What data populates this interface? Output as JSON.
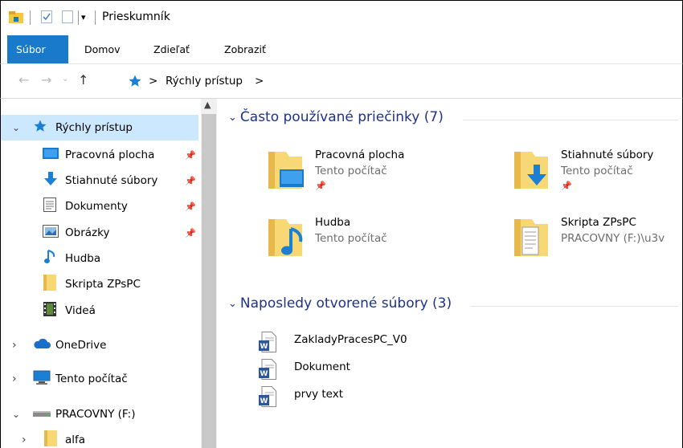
{
  "window": {
    "title": "Prieskumník"
  },
  "ribbon": {
    "tabs": [
      "Súbor",
      "Domov",
      "Zdieľať",
      "Zobraziť"
    ]
  },
  "address": {
    "path": [
      "Rýchly prístup"
    ],
    "separator": ">"
  },
  "sidebar": {
    "items": [
      {
        "label": "Rýchly prístup",
        "icon": "star-icon",
        "expander": "expanded",
        "selected": true
      },
      {
        "label": "Pracovná plocha",
        "icon": "desktop-icon",
        "pinned": true
      },
      {
        "label": "Stiahnuté súbory",
        "icon": "download-icon",
        "pinned": true
      },
      {
        "label": "Dokumenty",
        "icon": "document-icon",
        "pinned": true
      },
      {
        "label": "Obrázky",
        "icon": "pictures-icon",
        "pinned": true
      },
      {
        "label": "Hudba",
        "icon": "music-icon"
      },
      {
        "label": "Skripta ZPsPC",
        "icon": "folder-icon"
      },
      {
        "label": "Videá",
        "icon": "video-icon"
      },
      {
        "label": "OneDrive",
        "icon": "cloud-icon",
        "expander": "collapsed"
      },
      {
        "label": "Tento počítač",
        "icon": "computer-icon",
        "expander": "collapsed"
      },
      {
        "label": "PRACOVNY (F:)",
        "icon": "drive-icon",
        "expander": "expanded"
      },
      {
        "label": "alfa",
        "icon": "folder-icon",
        "expander": "collapsed"
      }
    ]
  },
  "frequent": {
    "heading": "Často používané priečinky (7)",
    "folders": [
      {
        "name": "Pracovná plocha",
        "location": "Tento počítač",
        "pinned": true,
        "icon": "desktop-folder-icon"
      },
      {
        "name": "Stiahnuté súbory",
        "location": "Tento počítač",
        "pinned": true,
        "icon": "downloads-folder-icon"
      },
      {
        "name": "Hudba",
        "location": "Tento počítač",
        "pinned": false,
        "icon": "music-folder-icon"
      },
      {
        "name": "Skripta ZPsPC",
        "location": "PRACOVNY (F:)\\u3v",
        "pinned": false,
        "icon": "documents-folder-icon"
      }
    ]
  },
  "recent": {
    "heading": "Naposledy otvorené súbory (3)",
    "files": [
      {
        "name": "ZakladyPracesPC_V0",
        "icon": "word-file-icon"
      },
      {
        "name": "Dokument",
        "icon": "word-file-icon"
      },
      {
        "name": "prvy text",
        "icon": "word-file-icon"
      }
    ]
  },
  "colors": {
    "accent": "#1979ca",
    "selection": "#cce8ff",
    "heading": "#1e3287",
    "folder": "#f8d775"
  }
}
